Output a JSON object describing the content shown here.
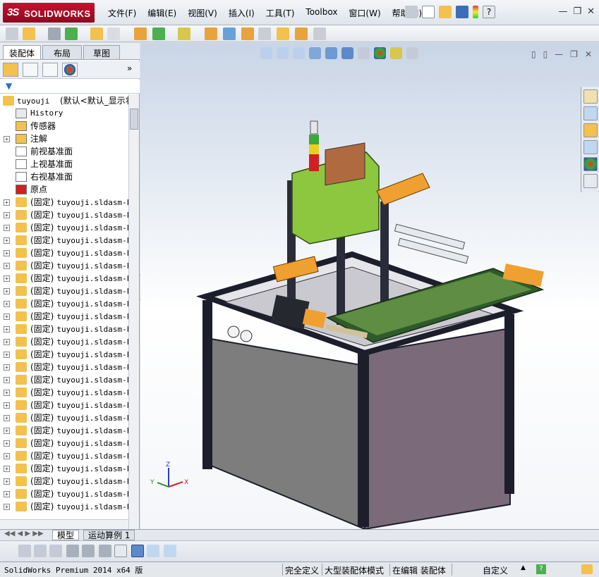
{
  "app": {
    "logo_prefix": "3S",
    "logo_name": "SOLIDWORKS"
  },
  "menu": [
    "文件(F)",
    "编辑(E)",
    "视图(V)",
    "插入(I)",
    "工具(T)",
    "Toolbox",
    "窗口(W)",
    "帮助(H)"
  ],
  "panel": {
    "tabs": [
      "装配体",
      "布局",
      "草图"
    ],
    "active_tab": "装配体"
  },
  "tree": {
    "root": {
      "name": "tuyouji",
      "config": "(默认<默认_显示状"
    },
    "fixed_items": [
      {
        "label": "History",
        "icon": "history-icon"
      },
      {
        "label": "传感器",
        "icon": "sensor-icon"
      },
      {
        "label": "注解",
        "icon": "annotation-icon"
      },
      {
        "label": "前视基准面",
        "icon": "plane-icon"
      },
      {
        "label": "上视基准面",
        "icon": "plane-icon"
      },
      {
        "label": "右视基准面",
        "icon": "plane-icon"
      },
      {
        "label": "原点",
        "icon": "origin-icon"
      }
    ],
    "component_prefix": "(固定)",
    "component_name": "tuyouji.sldasm-P",
    "component_count": 25
  },
  "bottom_tabs": [
    "模型",
    "运动算例 1"
  ],
  "status": {
    "product": "SolidWorks Premium 2014 x64 版",
    "definition": "完全定义",
    "mode": "大型装配体模式",
    "editing": "在编辑 装配体",
    "units": "自定义"
  },
  "colors": {
    "frame": "#1c1e2b",
    "panel_grey": "#7d7d7d",
    "panel_purple": "#7a6a7a",
    "green": "#8dc63f",
    "orange": "#f0a030",
    "sw_red": "#c8102e"
  }
}
